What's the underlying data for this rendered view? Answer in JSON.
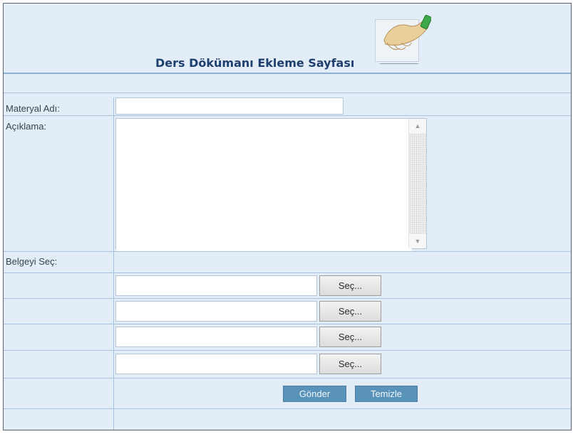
{
  "page": {
    "title": "Ders Dökümanı Ekleme Sayfası"
  },
  "form": {
    "material_name": {
      "label": "Materyal Adı:",
      "value": ""
    },
    "description": {
      "label": "Açıklama:",
      "value": ""
    },
    "files": {
      "label": "Belgeyi Seç:",
      "browse_label": "Seç...",
      "inputs": [
        "",
        "",
        "",
        ""
      ]
    },
    "actions": {
      "submit_label": "Gönder",
      "clear_label": "Temizle"
    }
  },
  "colors": {
    "panel_bg": "#e2edf8",
    "title_text": "#1f3f6e",
    "grid_line": "#a9c3dd",
    "action_button": "#5a93b9"
  },
  "icons": [
    "hand-logo-icon",
    "scroll-up-arrow-icon",
    "scroll-down-arrow-icon"
  ]
}
